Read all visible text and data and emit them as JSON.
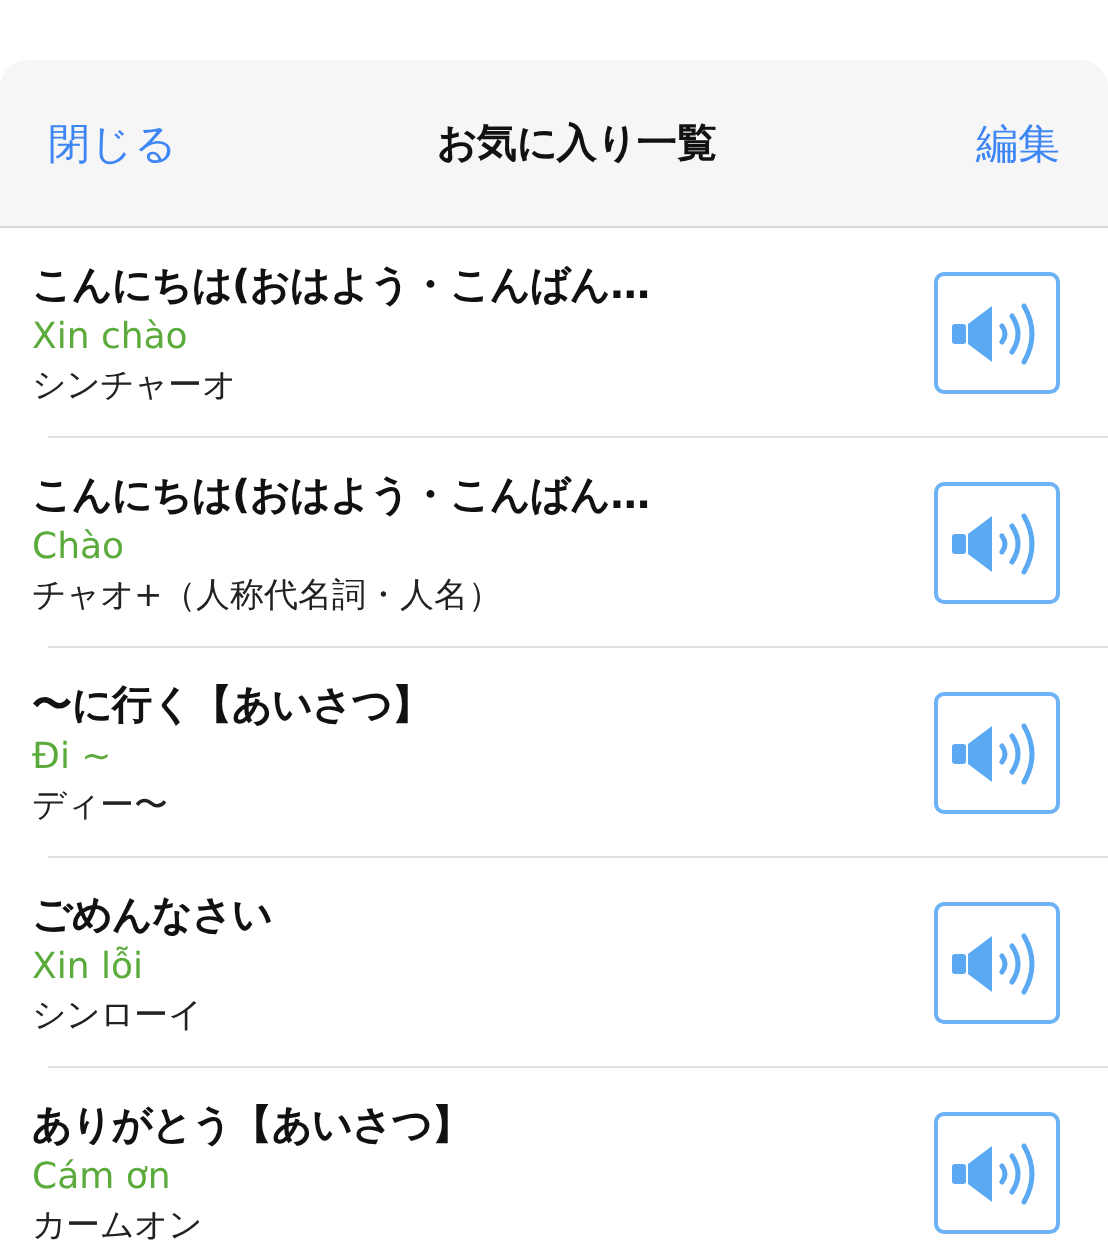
{
  "header": {
    "close": "閉じる",
    "title": "お気に入り一覧",
    "edit": "編集"
  },
  "items": [
    {
      "japanese": "こんにちは(おはよう・こんばん…",
      "vietnamese": "Xin chào",
      "reading": "シンチャーオ"
    },
    {
      "japanese": "こんにちは(おはよう・こんばん…",
      "vietnamese": "Chào",
      "reading": "チャオ+（人称代名詞・人名）"
    },
    {
      "japanese": "〜に行く【あいさつ】",
      "vietnamese": "Đi ~",
      "reading": "ディー〜"
    },
    {
      "japanese": "ごめんなさい",
      "vietnamese": "Xin lỗi",
      "reading": "シンローイ"
    },
    {
      "japanese": "ありがとう【あいさつ】",
      "vietnamese": "Cám ơn",
      "reading": "カームオン"
    }
  ]
}
